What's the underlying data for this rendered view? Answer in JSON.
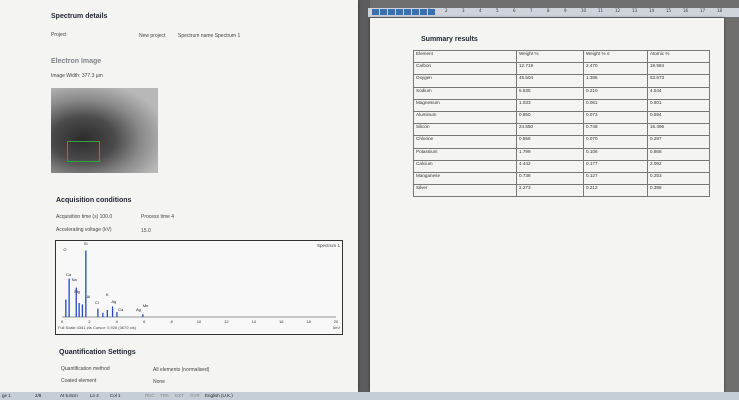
{
  "left": {
    "spectrum_details": "Spectrum details",
    "project_label": "Project",
    "project_value": "New project",
    "spectrum_name": "Spectrum name Spectrum 1",
    "electron_image": "Electron Image",
    "image_width": "Image Width: 377.3 µm",
    "acq_title": "Acquisition conditions",
    "acq_time": "Acquisition time (s)  100.0",
    "process_time": "Process time  4",
    "acc_voltage": "Accelerating voltage (kV)",
    "acc_value": "15.0",
    "spectrum_label": "Spectrum 1",
    "spectrum_footer": "Full Scale 4341 cts Cursor: 0.926  (3670 cts)",
    "x_ticks": [
      "0",
      "2",
      "4",
      "6",
      "8",
      "10",
      "12",
      "14",
      "16",
      "18",
      "20"
    ],
    "x_unit": "keV",
    "peak_labels": [
      "O",
      "Si",
      "Na",
      "Mg",
      "Ca",
      "K",
      "Al",
      "Cl",
      "Ag",
      "Ca",
      "Ag",
      "Mn"
    ],
    "quant_title": "Quantification Settings",
    "quant_method": "Quantification method",
    "quant_method_value": "All elements (normalised)",
    "coated": "Coated element",
    "coated_value": "None"
  },
  "right": {
    "summary_title": "Summary results",
    "headers": [
      "Element",
      "Weight %",
      "Weight % σ",
      "Atomic %"
    ],
    "rows": [
      [
        "Carbon",
        "12.719",
        "2.470",
        "19.984"
      ],
      [
        "Oxygen",
        "45.504",
        "1.386",
        "53.673"
      ],
      [
        "Sodium",
        "5.535",
        "0.210",
        "4.544"
      ],
      [
        "Magnesium",
        "1.033",
        "0.061",
        "0.801"
      ],
      [
        "Aluminum",
        "0.850",
        "0.073",
        "0.594"
      ],
      [
        "Silicon",
        "24.550",
        "0.748",
        "16.496"
      ],
      [
        "Chlorine",
        "0.556",
        "0.070",
        "0.297"
      ],
      [
        "Potassium",
        "1.799",
        "0.106",
        "0.868"
      ],
      [
        "Calcium",
        "4.442",
        "0.177",
        "2.092"
      ],
      [
        "Manganese",
        "0.738",
        "0.127",
        "0.253"
      ],
      [
        "Silver",
        "2.273",
        "0.212",
        "0.398"
      ]
    ]
  },
  "ruler_numbers": [
    "1",
    "2",
    "3",
    "4",
    "5",
    "6",
    "7",
    "8",
    "9",
    "10",
    "11",
    "12",
    "13",
    "14",
    "15",
    "16",
    "17",
    "18"
  ],
  "statusbar": {
    "page": "ge 1",
    "count": "2/8",
    "at": "At 5.8cm",
    "ln": "Ln 4",
    "col": "Col 1",
    "rec": "REC",
    "trk": "TRK",
    "ext": "EXT",
    "ovr": "OVR",
    "lang": "English (U.K.)"
  }
}
